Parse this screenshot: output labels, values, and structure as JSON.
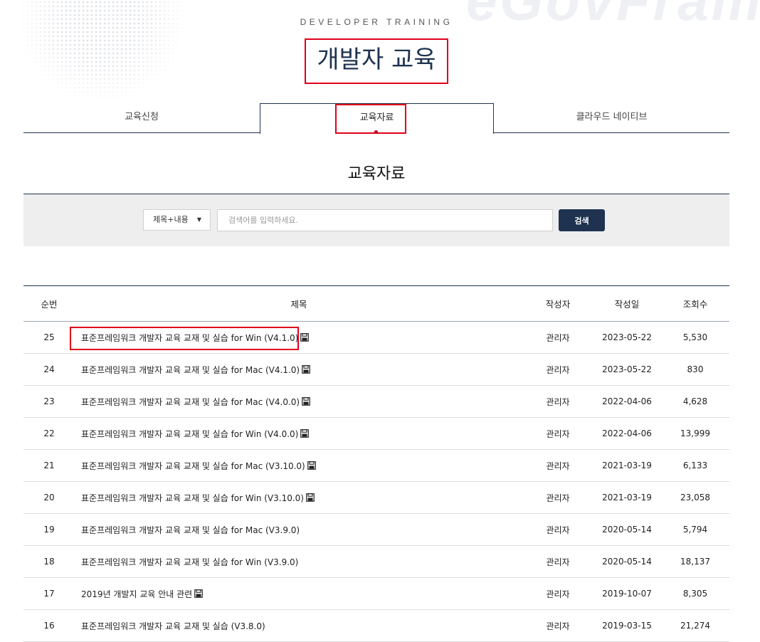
{
  "header": {
    "watermark": "eGovFrame",
    "eyebrow": "DEVELOPER TRAINING",
    "title": "개발자 교육"
  },
  "tabs": [
    {
      "label": "교육신청",
      "active": false
    },
    {
      "label": "교육자료",
      "active": true
    },
    {
      "label": "클라우드 네이티브",
      "active": false
    }
  ],
  "section": {
    "title": "교육자료"
  },
  "search": {
    "select_value": "제목+내용",
    "placeholder": "검색어를 입력하세요.",
    "button_label": "검색"
  },
  "table": {
    "headers": {
      "num": "순번",
      "title": "제목",
      "author": "작성자",
      "date": "작성일",
      "views": "조회수"
    },
    "rows": [
      {
        "num": "25",
        "title": "표준프레임워크 개발자 교육 교재 및 실습 for Win (V4.1.0)",
        "has_file": true,
        "author": "관리자",
        "date": "2023-05-22",
        "views": "5,530"
      },
      {
        "num": "24",
        "title": "표준프레임워크 개발자 교육 교재 및 실습 for Mac (V4.1.0)",
        "has_file": true,
        "author": "관리자",
        "date": "2023-05-22",
        "views": "830"
      },
      {
        "num": "23",
        "title": "표준프레임워크 개발자 교육 교재 및 실습 for Mac (V4.0.0)",
        "has_file": true,
        "author": "관리자",
        "date": "2022-04-06",
        "views": "4,628"
      },
      {
        "num": "22",
        "title": "표준프레임워크 개발자 교육 교재 및 실습 for Win (V4.0.0)",
        "has_file": true,
        "author": "관리자",
        "date": "2022-04-06",
        "views": "13,999"
      },
      {
        "num": "21",
        "title": "표준프레임워크 개발자 교육 교재 및 실습 for Mac (V3.10.0)",
        "has_file": true,
        "author": "관리자",
        "date": "2021-03-19",
        "views": "6,133"
      },
      {
        "num": "20",
        "title": "표준프레임워크 개발자 교육 교재 및 실습 for Win (V3.10.0)",
        "has_file": true,
        "author": "관리자",
        "date": "2021-03-19",
        "views": "23,058"
      },
      {
        "num": "19",
        "title": "표준프레임워크 개발자 교육 교재 및 실습 for Mac (V3.9.0)",
        "has_file": false,
        "author": "관리자",
        "date": "2020-05-14",
        "views": "5,794"
      },
      {
        "num": "18",
        "title": "표준프레임워크 개발자 교육 교재 및 실습 for Win (V3.9.0)",
        "has_file": false,
        "author": "관리자",
        "date": "2020-05-14",
        "views": "18,137"
      },
      {
        "num": "17",
        "title": "2019년 개발지 교육 안내 관련",
        "has_file": true,
        "author": "관리자",
        "date": "2019-10-07",
        "views": "8,305"
      },
      {
        "num": "16",
        "title": "표준프레임워크 개발자 교육 교재 및 실습 (V3.8.0)",
        "has_file": false,
        "author": "관리자",
        "date": "2019-03-15",
        "views": "21,274"
      }
    ]
  },
  "icons": {
    "select_caret": "caret-down-icon",
    "attachment": "floppy-disk-icon"
  },
  "colors": {
    "accent": "#1f3350",
    "highlight": "#e0001a",
    "search_bg": "#eeeeee"
  }
}
